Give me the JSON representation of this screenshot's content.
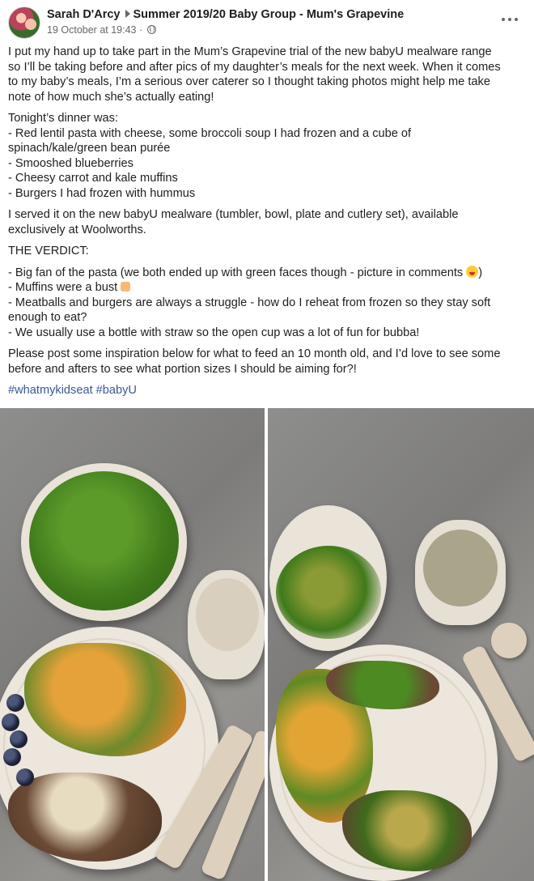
{
  "post": {
    "author": "Sarah D'Arcy",
    "group": "Summer 2019/20 Baby Group - Mum's Grapevine",
    "timestamp": "19 October at 19:43 ·",
    "intro": [
      "I put my hand up to take part in the Mum’s Grapevine trial of the new babyU mealware range",
      "so I’ll be taking before and after pics of my daughter’s meals for the next week. When it comes",
      "to my baby’s meals, I’m a serious over caterer so I thought taking photos might help me take",
      "note of how much she’s actually eating!"
    ],
    "dinner": [
      "Tonight’s dinner was:",
      "- Red lentil pasta with cheese, some broccoli soup I had frozen and a cube of",
      "spinach/kale/green bean purée",
      "- Smooshed blueberries",
      "- Cheesy carrot and kale muffins",
      "- Burgers I had frozen with hummus"
    ],
    "served": [
      "I served it on the new babyU mealware (tumbler, bowl, plate and cutlery set), available",
      "exclusively at Woolworths."
    ],
    "verdict_heading": "THE VERDICT:",
    "verdict": {
      "pasta": "- Big fan of the pasta (we both ended up with green faces though - picture in comments",
      "pasta_end": ")",
      "muffins": "- Muffins were a bust",
      "meatballs_1": "- Meatballs and burgers are always a struggle - how do I reheat from frozen so they stay soft",
      "meatballs_2": "enough to eat?",
      "bottle": "- We usually use a bottle with straw so the open cup was a lot of fun for bubba!"
    },
    "closing": [
      "Please post some inspiration below for what to feed an 10 month old, and I’d love to see some",
      "before and afters to see what portion sizes I should be aiming for?!"
    ],
    "hashtags": [
      "#whatmykidseat",
      "#babyU"
    ]
  },
  "icons": {
    "privacy": "globe-icon",
    "more": "more-options-icon",
    "emoji_grin": "grinning-emoji-icon",
    "emoji_thumb": "thumbs-down-emoji-icon"
  },
  "colors": {
    "link": "#385898",
    "meta": "#65676b",
    "text": "#1c1e21"
  }
}
